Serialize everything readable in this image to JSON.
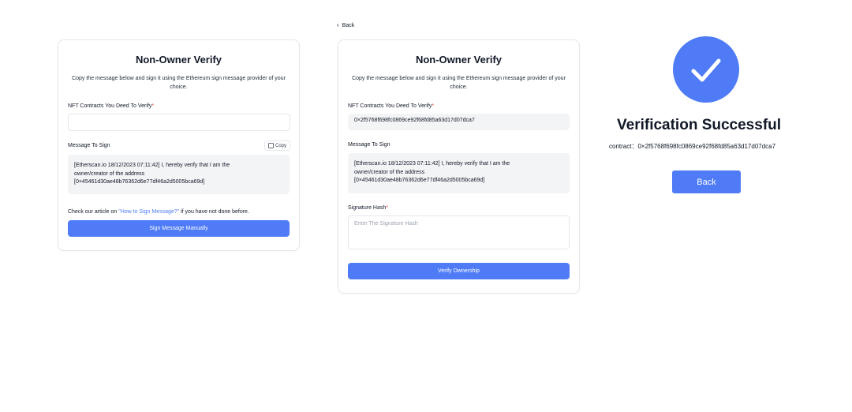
{
  "back_link": {
    "icon": "chevron-left-icon",
    "label": "Back"
  },
  "panel_left": {
    "title": "Non-Owner Verify",
    "description": "Copy the message below and sign it using the Ethereum sign message provider of your choice.",
    "contracts_label": "NFT Contracts You Deed To Verify",
    "required_mark": "*",
    "contracts_value": "",
    "message_label": "Message To Sign",
    "copy_label": "Copy",
    "message_line1": "[Etherscan.io 18/12/2023 07:11:42] I, hereby verify that I am the",
    "message_line2": "owner/creator of the address",
    "message_line3": "[0×45461d30ae48b76362d6e77df46a2d5005bca69d]",
    "help_prefix": "Check our article on ",
    "help_link": "\"How to Sign Message?\"",
    "help_suffix": " if you have not done before.",
    "sign_button": "Sign Message Manually"
  },
  "panel_middle": {
    "title": "Non-Owner Verify",
    "description": "Copy the message below and sign it using the Ethereum sign message provider of your choice.",
    "contracts_label": "NFT Contracts You Deed To Verify",
    "required_mark": "*",
    "contracts_value": "0×2f5768f698fc0869ce92f68fd85a63d17d07dca7",
    "message_label": "Message To Sign",
    "message_line1": "[Etherscan.io 18/12/2023 07:11:42] I, hereby verify that I am the",
    "message_line2": "owner/creator of the address",
    "message_line3": "[0×45461d30ae48b76362d6e77df46a2d5005bca69d]",
    "signature_label": "Signature Hash",
    "signature_placeholder": "Enter The Signature Hash",
    "verify_button": "Verify Ownership"
  },
  "success": {
    "icon": "checkmark-icon",
    "title": "Verification Successful",
    "contract_line": "contract：0×2f5768f698fc0869ce92f68fd85a63d17d07dca7",
    "back_button": "Back"
  },
  "colors": {
    "accent": "#4f7cf6",
    "required": "#ef4444",
    "field_bg": "#f3f4f6",
    "border": "#e5e7eb"
  }
}
